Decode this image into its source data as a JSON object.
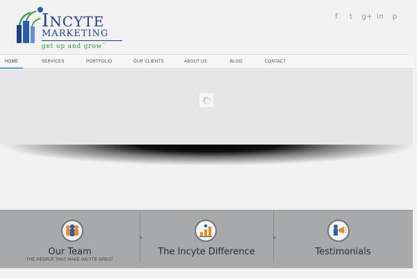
{
  "brand": {
    "title_initial": "I",
    "title_rest": "NCYTE",
    "subtitle": "MARKETING",
    "tagline": "get up and grow",
    "tagline_mark": "™"
  },
  "social": [
    {
      "icon": "facebook-icon",
      "glyph": "f"
    },
    {
      "icon": "twitter-icon",
      "glyph": "t"
    },
    {
      "icon": "google-plus-icon",
      "glyph": "g+"
    },
    {
      "icon": "linkedin-icon",
      "glyph": "in"
    },
    {
      "icon": "pinterest-icon",
      "glyph": "p"
    }
  ],
  "nav": {
    "items": [
      {
        "label": "HOME",
        "active": true
      },
      {
        "label": "SERVICES"
      },
      {
        "label": "PORTFOLIO"
      },
      {
        "label": "OUR CLIENTS"
      },
      {
        "label": "ABOUT US"
      },
      {
        "label": "BLOG"
      },
      {
        "label": "CONTACT"
      }
    ]
  },
  "features": [
    {
      "title": "Our Team",
      "subtitle": "THE PEOPLE THAT MAKE INCYTE GREAT",
      "icon": "team-icon"
    },
    {
      "title": "The Incyte Difference",
      "subtitle": "",
      "icon": "growth-chart-icon"
    },
    {
      "title": "Testimonials",
      "subtitle": "",
      "icon": "megaphone-icon"
    }
  ],
  "colors": {
    "brand_blue": "#1d3f8f",
    "brand_green": "#2a9a3a",
    "band_gray": "#a6aaad",
    "nav_active": "#5aa0c8"
  }
}
